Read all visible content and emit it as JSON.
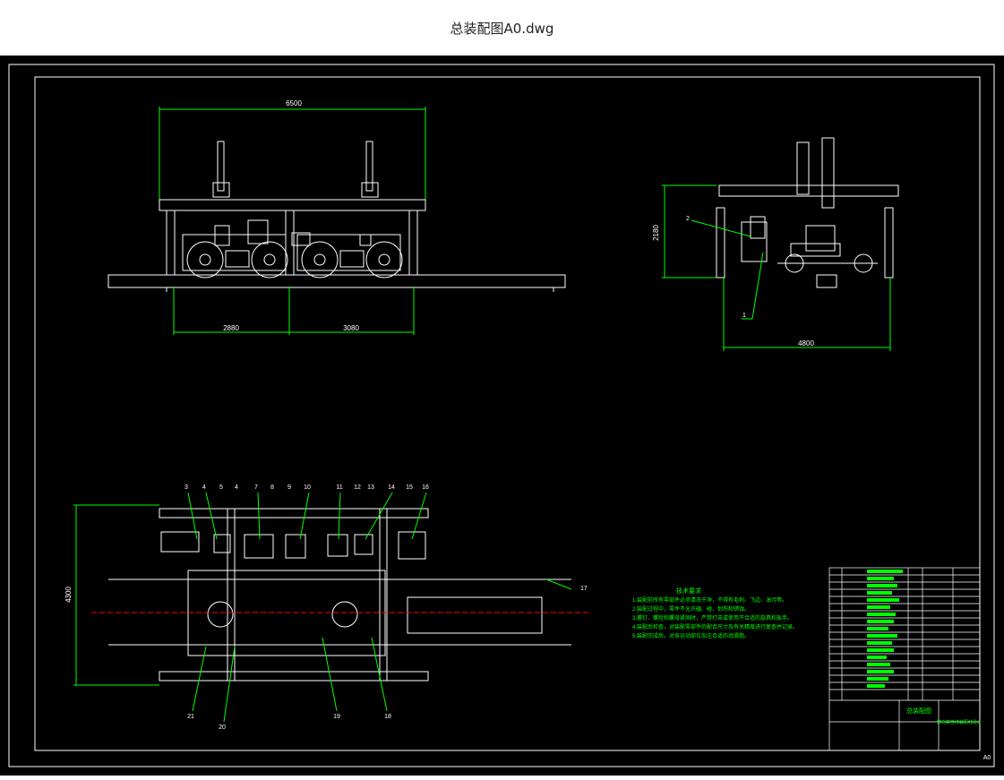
{
  "title": "总装配图A0.dwg",
  "colors": {
    "background": "#000000",
    "line": "#ffffff",
    "dimension": "#00ff00",
    "accent": "#ff0000"
  },
  "front_view": {
    "width_dim": "6500",
    "span_left": "2880",
    "span_right": "3080"
  },
  "side_view": {
    "height_dim": "2180",
    "width_dim": "4800",
    "callout_1": "1",
    "callout_2": "2"
  },
  "top_view": {
    "height_dim": "4300",
    "top_callouts": [
      "3",
      "4",
      "5",
      "4",
      "7",
      "8",
      "9",
      "10",
      "11",
      "12",
      "13",
      "14",
      "15",
      "16"
    ],
    "right_callout": "17",
    "bottom_callouts": [
      "21",
      "20",
      "19",
      "18"
    ]
  },
  "notes": {
    "heading": "技术要求",
    "lines": [
      "1.装配前所有零部件必须清洗干净，不得有毛刺、飞边、油污等。",
      "2.装配过程中，零件不允许磕、碰、划伤和锈蚀。",
      "3.螺钉、螺栓和螺母紧固时，严禁打击或使用不合适的旋具和扳手。",
      "4.装配后检查，对装配零部件的配合尺寸及有关精度进行复查并记录。",
      "5.装配完成后，对各运动部位加注合适的润滑脂。"
    ]
  },
  "title_block": {
    "drawing_name": "总装配图",
    "company": "转向架检修装配线设计",
    "sheet_size": "A0"
  }
}
